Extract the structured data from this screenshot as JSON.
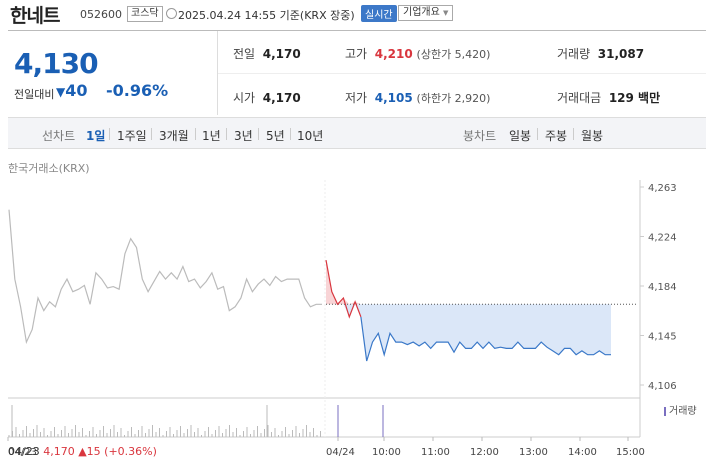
{
  "header": {
    "name": "한네트",
    "code": "052600",
    "market": "코스닥",
    "datetime": "2025.04.24 14:55 기준(KRX 장중)",
    "realtime": "실시간",
    "corp_info": "기업개요"
  },
  "summary": {
    "price": "4,130",
    "change_label": "전일대비",
    "change_value": "40",
    "change_pct": "-0.96%",
    "prev_close_label": "전일",
    "prev_close": "4,170",
    "open_label": "시가",
    "open": "4,170",
    "high_label": "고가",
    "high": "4,210",
    "upper_limit": "(상한가 5,420)",
    "low_label": "저가",
    "low": "4,105",
    "lower_limit": "(하한가 2,920)",
    "volume_label": "거래량",
    "volume": "31,087",
    "amount_label": "거래대금",
    "amount": "129 백만"
  },
  "toolbar": {
    "line_label": "선차트",
    "ranges": [
      "1일",
      "1주일",
      "3개월",
      "1년",
      "3년",
      "5년",
      "10년"
    ],
    "selected_range": "1일",
    "candle_label": "봉차트",
    "candle_ranges": [
      "일봉",
      "주봉",
      "월봉"
    ]
  },
  "exchange": "한국거래소(KRX)",
  "footer": {
    "prev_date": "04/23",
    "prev_price": "4,170",
    "prev_change": "15",
    "prev_pct": "(+0.36%)"
  },
  "chart_data": {
    "type": "line",
    "title": "",
    "xlabel": "",
    "ylabel": "",
    "ylim": [
      4106,
      4263
    ],
    "y_ticks": [
      "4,263",
      "4,224",
      "4,184",
      "4,145",
      "4,106"
    ],
    "x_ticks": [
      "04/23",
      "04/24",
      "10:00",
      "11:00",
      "12:00",
      "13:00",
      "14:00",
      "15:00"
    ],
    "reference_line": 4170,
    "colors": {
      "prev_day": "#bbbbbb",
      "up": "#d9363e",
      "down": "#3a78c8",
      "fill": "#dbe7f8",
      "volume": "#7a6fc0"
    },
    "volume_legend": "거래량",
    "series": [
      {
        "values": [
          4245,
          4190,
          4168,
          4140,
          4150,
          4175,
          4165,
          4172,
          4168,
          4182,
          4190,
          4180,
          4182,
          4185,
          4170,
          4195,
          4190,
          4183,
          4184,
          4182,
          4210,
          4222,
          4215,
          4190,
          4180,
          4188,
          4196,
          4190,
          4195,
          4190,
          4200,
          4188,
          4190,
          4183,
          4188,
          4195,
          4182,
          4184,
          4165,
          4168,
          4175,
          4190,
          4180,
          4186,
          4190,
          4185,
          4192,
          4188,
          4190,
          4190,
          4190,
          4175,
          4168,
          4170,
          4170
        ]
      },
      {
        "values": [
          4205,
          4180,
          4170,
          4175,
          4160,
          4172,
          4160,
          4125,
          4140,
          4147,
          4130,
          4147,
          4140,
          4140,
          4138,
          4140,
          4137,
          4140,
          4135,
          4140,
          4140,
          4140,
          4132,
          4140,
          4135,
          4135,
          4140,
          4135,
          4140,
          4135,
          4136,
          4135,
          4135,
          4140,
          4135,
          4135,
          4135,
          4140,
          4136,
          4133,
          4130,
          4135,
          4135,
          4130,
          4133,
          4130,
          4130,
          4133,
          4130,
          4130
        ]
      }
    ]
  }
}
